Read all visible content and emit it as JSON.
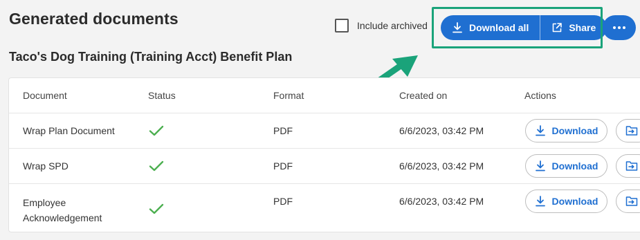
{
  "header": {
    "title": "Generated documents",
    "include_archived_label": "Include archived",
    "download_all_label": "Download all",
    "share_label": "Share"
  },
  "plan_title": "Taco's Dog Training (Training Acct) Benefit Plan",
  "table": {
    "columns": [
      "Document",
      "Status",
      "Format",
      "Created on",
      "Actions"
    ],
    "rows": [
      {
        "document": "Wrap Plan Document",
        "status": "check-icon",
        "format": "PDF",
        "created_on": "6/6/2023, 03:42 PM",
        "action_label": "Download"
      },
      {
        "document": "Wrap SPD",
        "status": "check-icon",
        "format": "PDF",
        "created_on": "6/6/2023, 03:42 PM",
        "action_label": "Download"
      },
      {
        "document_line1": "Employee",
        "document_line2": "Acknowledgement",
        "status": "check-icon",
        "format": "PDF",
        "created_on": "6/6/2023, 03:42 PM",
        "action_label": "Download"
      }
    ]
  },
  "colors": {
    "primary": "#1f6fd1",
    "success": "#4caf50",
    "annotation": "#1aa37a"
  }
}
